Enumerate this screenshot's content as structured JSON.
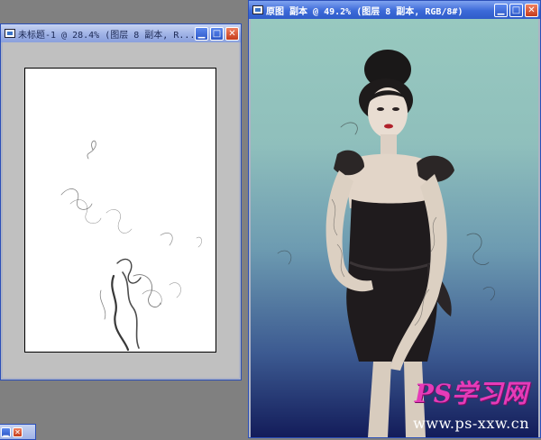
{
  "left_window": {
    "title": "未标题-1 @ 28.4% (图层 8 副本, R..."
  },
  "right_window": {
    "title": "原图 副本 @ 49.2% (图层 8 副本, RGB/8#)"
  },
  "buttons": {
    "minimize": "▁",
    "maximize": "□",
    "close": "✕"
  },
  "watermark": {
    "brand": "PS学习网",
    "url": "www.ps-xxw.cn"
  },
  "colors": {
    "titlebar_active": "#3c6ad8",
    "titlebar_inactive": "#9fb2e6",
    "workspace": "#808080",
    "watermark_brand": "#e53bb8"
  }
}
